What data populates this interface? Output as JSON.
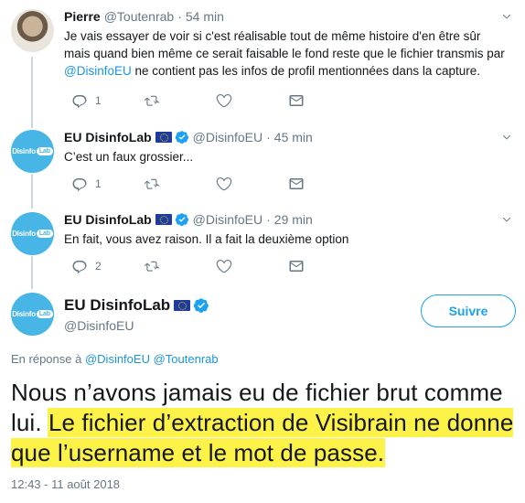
{
  "tweets": [
    {
      "name": "Pierre",
      "handle": "@Toutenrab",
      "separator": "·",
      "time": "54 min",
      "text_before": "Je vais essayer de voir si c'est réalisable tout de même histoire d'en être sûr mais quand bien même ce serait faisable le fond reste que le fichier transmis par ",
      "mention": "@DisinfoEU",
      "text_after": " ne contient pas les infos de profil mentionnées dans la capture.",
      "reply_count": "1",
      "retweet_count": "",
      "like_count": ""
    },
    {
      "name": "EU DisinfoLab",
      "handle": "@DisinfoEU",
      "separator": "·",
      "time": "45 min",
      "text": "C’est un faux grossier...",
      "reply_count": "1",
      "retweet_count": "",
      "like_count": ""
    },
    {
      "name": "EU DisinfoLab",
      "handle": "@DisinfoEU",
      "separator": "·",
      "time": "29 min",
      "text": "En fait, vous avez raison. Il a fait la deuxième option",
      "reply_count": "2",
      "retweet_count": "",
      "like_count": ""
    }
  ],
  "brand_logo": {
    "word": "DisinfoLab",
    "left": "Disinfo",
    "bubble": "Lab"
  },
  "main_tweet": {
    "name": "EU DisinfoLab",
    "handle": "@DisinfoEU",
    "follow_label": "Suivre",
    "reply_prefix": "En réponse à",
    "reply_mention_1": "@DisinfoEU",
    "reply_mention_2": "@Toutenrab",
    "text_plain": "Nous n’avons jamais eu de fichier brut comme lui. ",
    "text_highlighted": "Le fichier d’extraction de Visibrain ne donne que l’username et le mot de passe.",
    "timestamp": "12:43 - 11 août 2018"
  },
  "colors": {
    "accent": "#1da1f2",
    "mention": "#1b95e0",
    "secondary_text": "#657786",
    "highlight": "#fdf247",
    "brand": "#47b6e6"
  },
  "icons": [
    "reply-icon",
    "retweet-icon",
    "like-icon",
    "dm-icon",
    "verified-icon",
    "eu-flag-icon",
    "caret-down-icon"
  ]
}
